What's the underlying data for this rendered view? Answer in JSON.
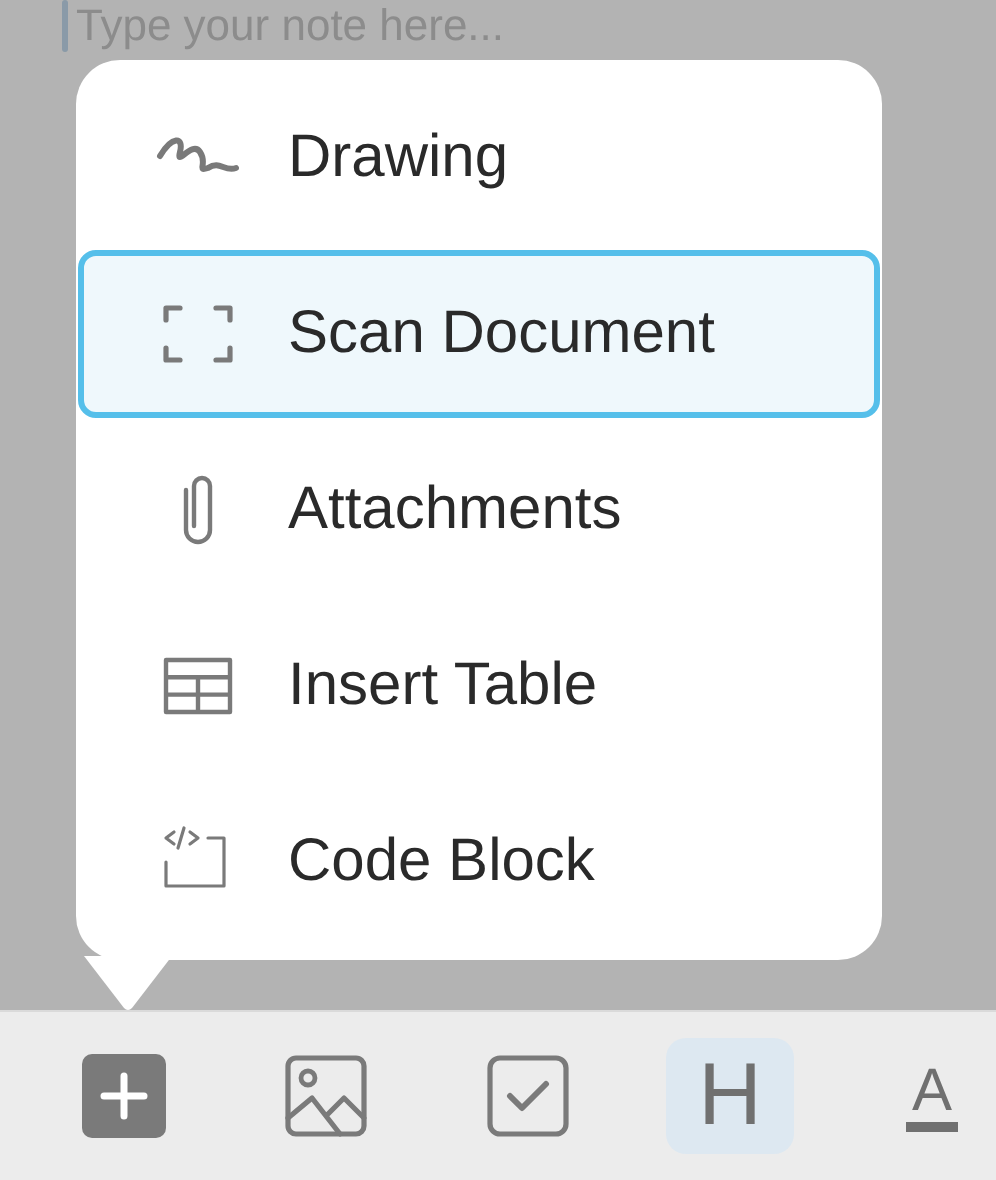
{
  "editor": {
    "placeholder": "Type your note here..."
  },
  "menu": {
    "items": [
      {
        "label": "Drawing",
        "kind": "drawing",
        "selected": false
      },
      {
        "label": "Scan Document",
        "kind": "scan",
        "selected": true
      },
      {
        "label": "Attachments",
        "kind": "attachment",
        "selected": false
      },
      {
        "label": "Insert Table",
        "kind": "table",
        "selected": false
      },
      {
        "label": "Code Block",
        "kind": "code",
        "selected": false
      }
    ]
  },
  "toolbar": {
    "items": [
      {
        "kind": "plus",
        "selected": false
      },
      {
        "kind": "image",
        "selected": false
      },
      {
        "kind": "checkbox",
        "selected": false
      },
      {
        "kind": "text",
        "text": "H",
        "selected": true
      },
      {
        "kind": "underline-text",
        "text": "A",
        "selected": false
      }
    ]
  }
}
